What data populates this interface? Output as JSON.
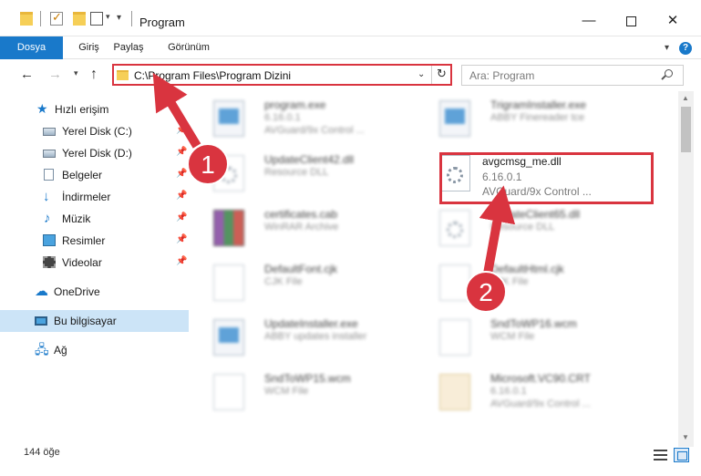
{
  "window": {
    "title": "Program",
    "minimize_glyph": "—",
    "close_glyph": "✕"
  },
  "ribbon": {
    "tabs": [
      "Dosya",
      "Giriş",
      "Paylaş",
      "Görünüm"
    ],
    "help": "?"
  },
  "nav": {
    "address": "C:\\Program Files\\Program Dizini",
    "search_placeholder": "Ara: Program"
  },
  "sidebar": {
    "quick_access": "Hızlı erişim",
    "items": [
      {
        "label": "Yerel Disk (C:)",
        "pinned": true
      },
      {
        "label": "Yerel Disk (D:)",
        "pinned": true
      },
      {
        "label": "Belgeler",
        "pinned": true
      },
      {
        "label": "İndirmeler",
        "pinned": true
      },
      {
        "label": "Müzik",
        "pinned": true
      },
      {
        "label": "Resimler",
        "pinned": true
      },
      {
        "label": "Videolar",
        "pinned": true
      }
    ],
    "onedrive": "OneDrive",
    "this_pc": "Bu bilgisayar",
    "network": "Ağ"
  },
  "files": [
    {
      "name": "program.exe",
      "meta1": "6.16.0.1",
      "meta2": "AVGuard/9x Control ...",
      "icon": "exe-icon"
    },
    {
      "name": "TrigramInstaller.exe",
      "meta1": "ABBY Finereader tce",
      "meta2": "",
      "icon": "exe-icon"
    },
    {
      "name": "UpdateClient42.dll",
      "meta1": "Resource DLL",
      "meta2": "",
      "icon": "dll-icon"
    },
    {
      "name": "avgcmsg_me.dll",
      "meta1": "6.16.0.1",
      "meta2": "AVGuard/9x Control ...",
      "icon": "dll-icon"
    },
    {
      "name": "certificates.cab",
      "meta1": "WinRAR Archive",
      "meta2": "",
      "icon": "archive-icon"
    },
    {
      "name": "UpdateClient65.dll",
      "meta1": "Resource DLL",
      "meta2": "",
      "icon": "dll-icon"
    },
    {
      "name": "DefaultFont.cjk",
      "meta1": "CJK File",
      "meta2": "",
      "icon": "file-icon"
    },
    {
      "name": "DefaultHtml.cjk",
      "meta1": "CJK File",
      "meta2": "",
      "icon": "file-icon"
    },
    {
      "name": "UpdateInstaller.exe",
      "meta1": "ABBY updates installer",
      "meta2": "",
      "icon": "exe-icon"
    },
    {
      "name": "SndToWP16.wcm",
      "meta1": "WCM File",
      "meta2": "",
      "icon": "file-icon"
    },
    {
      "name": "SndToWP15.wcm",
      "meta1": "WCM File",
      "meta2": "",
      "icon": "file-icon"
    },
    {
      "name": "Microsoft.VC90.CRT",
      "meta1": "6.16.0.1",
      "meta2": "AVGuard/9x Control ...",
      "icon": "folder-icon"
    }
  ],
  "status": {
    "count": "144 öğe"
  },
  "annotations": {
    "marker1": "1",
    "marker2": "2",
    "color": "#d9343f"
  }
}
